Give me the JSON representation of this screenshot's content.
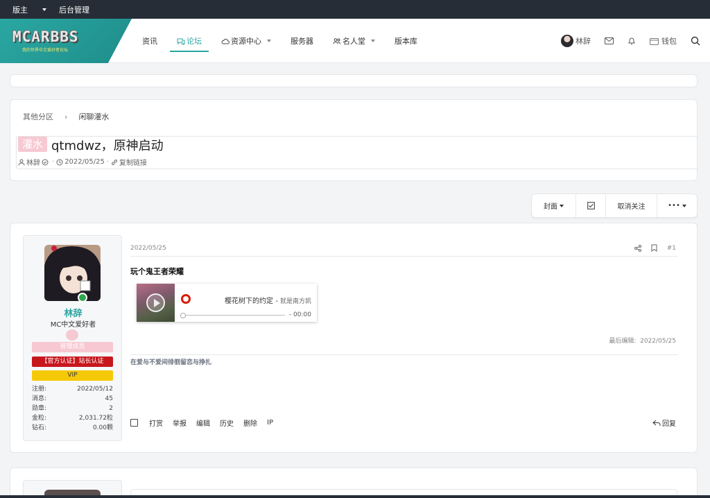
{
  "topbar": {
    "moderator_label": "版主",
    "admin_label": "后台管理"
  },
  "navbar": {
    "logo_text": "MCARBBS",
    "logo_sub": "我的世界中文爱好者论坛",
    "links": [
      {
        "label": "资讯"
      },
      {
        "label": "论坛",
        "active": true
      },
      {
        "label": "资源中心"
      },
      {
        "label": "服务器"
      },
      {
        "label": "名人堂"
      },
      {
        "label": "版本库"
      }
    ],
    "username": "林辞",
    "wallet_label": "钱包"
  },
  "breadcrumb": {
    "parent": "其他分区",
    "separator": "›",
    "current": "闲聊灌水"
  },
  "thread": {
    "prefix": "灌水",
    "title": "qtmdwz，原神启动",
    "author": "林辞",
    "date": "2022/05/25",
    "copy_link_label": "复制链接"
  },
  "actions": {
    "cover_label": "封面",
    "unfollow_label": "取消关注",
    "more_label": "•••"
  },
  "post": {
    "date": "2022/05/25",
    "number": "#1",
    "body": "玩个鬼王者荣耀",
    "player": {
      "song": "樱花树下的约定 - ",
      "artist": "就是南方凯",
      "time": "- 00:00"
    },
    "last_edit_label": "最后编辑:",
    "last_edit_date": "2022/05/25",
    "signature": "在爱与不爱间徘徊留恋与挣扎",
    "footer": [
      "打赏",
      "举报",
      "编辑",
      "历史",
      "删除",
      "IP"
    ],
    "reply_label": "回复"
  },
  "user": {
    "name": "林辞",
    "title": "MC中文爱好者",
    "group": "管理成员",
    "cert": "【官方认证】站长认证",
    "vip": "VIP",
    "stats": [
      {
        "label": "注册:",
        "value": "2022/05/12"
      },
      {
        "label": "消息:",
        "value": "45"
      },
      {
        "label": "勋章:",
        "value": "2"
      },
      {
        "label": "金粒:",
        "value": "2,031.72粒"
      },
      {
        "label": "钻石:",
        "value": "0.00颗"
      }
    ]
  },
  "colors": {
    "accent": "#2ba5a1",
    "topbar": "#262d36",
    "cert_red": "#c8161d",
    "vip_yellow": "#f5c90a",
    "badge_pink": "#f7c9d2"
  }
}
